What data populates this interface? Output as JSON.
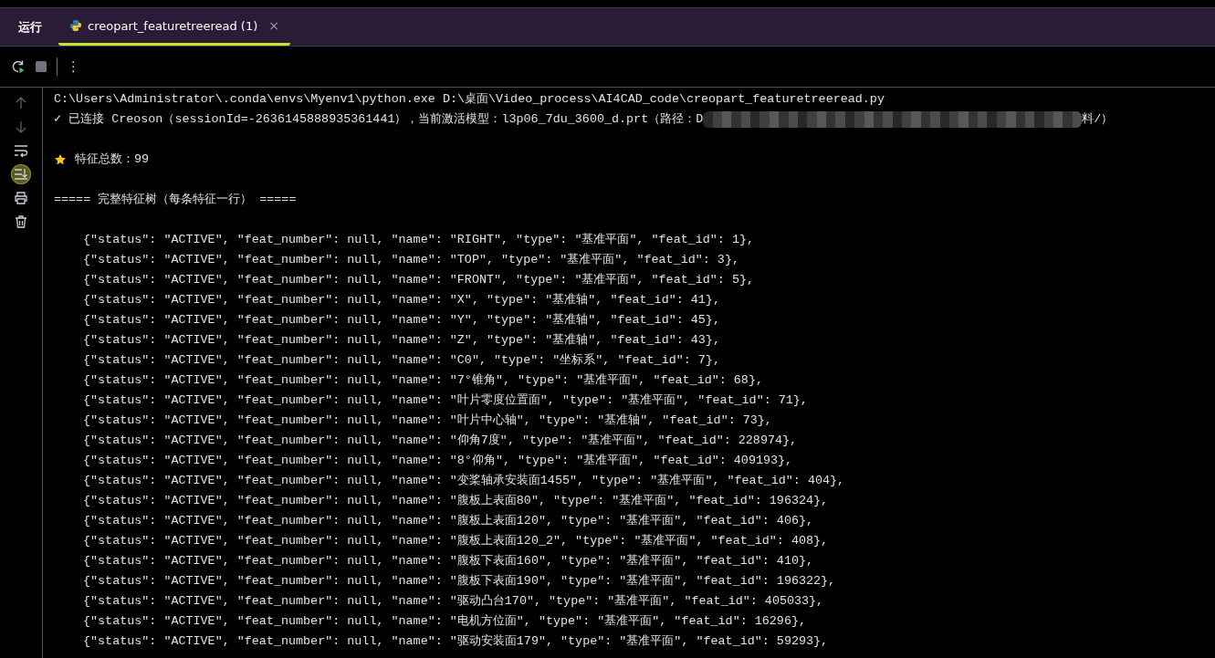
{
  "run_panel": {
    "title": "运行",
    "tabs": [
      {
        "label": "creopart_featuretreeread (1)",
        "selected": true,
        "close": "×"
      }
    ],
    "toolbar": [
      {
        "kind": "rerun"
      },
      {
        "kind": "stop"
      },
      {
        "kind": "divider"
      },
      {
        "kind": "more",
        "label": "⋮"
      }
    ],
    "side_tools": [
      {
        "kind": "up",
        "disabled": true,
        "on": false
      },
      {
        "kind": "down",
        "disabled": true,
        "on": false
      },
      {
        "kind": "wrap",
        "disabled": false,
        "on": false
      },
      {
        "kind": "scroll_end",
        "disabled": false,
        "on": true
      },
      {
        "kind": "print",
        "disabled": false,
        "on": false
      },
      {
        "kind": "trash",
        "disabled": false,
        "on": false
      }
    ],
    "console": {
      "lines": [
        {
          "kind": "command",
          "text": "C:\\Users\\Administrator\\.conda\\envs\\Myenv1\\python.exe D:\\桌面\\Video_process\\AI4CAD_code\\creopart_featuretreeread.py"
        },
        {
          "kind": "status",
          "text": "✓ 已连接 Creoson（sessionId=-2636145888935361441），当前激活模型：l3p06_7du_3600_d.prt（路径：D",
          "redacted": true,
          "tail": "料/）"
        },
        {
          "kind": "blank"
        },
        {
          "kind": "count",
          "text": "特征总数：99"
        },
        {
          "kind": "blank"
        },
        {
          "kind": "heading",
          "text": "===== 完整特征树（每条特征一行） ====="
        },
        {
          "kind": "blank"
        },
        {
          "kind": "row",
          "text": "{\"status\": \"ACTIVE\", \"feat_number\": null, \"name\": \"RIGHT\", \"type\": \"基准平面\", \"feat_id\": 1},"
        },
        {
          "kind": "row",
          "text": "{\"status\": \"ACTIVE\", \"feat_number\": null, \"name\": \"TOP\", \"type\": \"基准平面\", \"feat_id\": 3},"
        },
        {
          "kind": "row",
          "text": "{\"status\": \"ACTIVE\", \"feat_number\": null, \"name\": \"FRONT\", \"type\": \"基准平面\", \"feat_id\": 5},"
        },
        {
          "kind": "row",
          "text": "{\"status\": \"ACTIVE\", \"feat_number\": null, \"name\": \"X\", \"type\": \"基准轴\", \"feat_id\": 41},"
        },
        {
          "kind": "row",
          "text": "{\"status\": \"ACTIVE\", \"feat_number\": null, \"name\": \"Y\", \"type\": \"基准轴\", \"feat_id\": 45},"
        },
        {
          "kind": "row",
          "text": "{\"status\": \"ACTIVE\", \"feat_number\": null, \"name\": \"Z\", \"type\": \"基准轴\", \"feat_id\": 43},"
        },
        {
          "kind": "row",
          "text": "{\"status\": \"ACTIVE\", \"feat_number\": null, \"name\": \"C0\", \"type\": \"坐标系\", \"feat_id\": 7},"
        },
        {
          "kind": "row",
          "text": "{\"status\": \"ACTIVE\", \"feat_number\": null, \"name\": \"7°锥角\", \"type\": \"基准平面\", \"feat_id\": 68},"
        },
        {
          "kind": "row",
          "text": "{\"status\": \"ACTIVE\", \"feat_number\": null, \"name\": \"叶片零度位置面\", \"type\": \"基准平面\", \"feat_id\": 71},"
        },
        {
          "kind": "row",
          "text": "{\"status\": \"ACTIVE\", \"feat_number\": null, \"name\": \"叶片中心轴\", \"type\": \"基准轴\", \"feat_id\": 73},"
        },
        {
          "kind": "row",
          "text": "{\"status\": \"ACTIVE\", \"feat_number\": null, \"name\": \"仰角7度\", \"type\": \"基准平面\", \"feat_id\": 228974},"
        },
        {
          "kind": "row",
          "text": "{\"status\": \"ACTIVE\", \"feat_number\": null, \"name\": \"8°仰角\", \"type\": \"基准平面\", \"feat_id\": 409193},"
        },
        {
          "kind": "row",
          "text": "{\"status\": \"ACTIVE\", \"feat_number\": null, \"name\": \"变桨轴承安装面1455\", \"type\": \"基准平面\", \"feat_id\": 404},"
        },
        {
          "kind": "row",
          "text": "{\"status\": \"ACTIVE\", \"feat_number\": null, \"name\": \"腹板上表面80\", \"type\": \"基准平面\", \"feat_id\": 196324},"
        },
        {
          "kind": "row",
          "text": "{\"status\": \"ACTIVE\", \"feat_number\": null, \"name\": \"腹板上表面120\", \"type\": \"基准平面\", \"feat_id\": 406},"
        },
        {
          "kind": "row",
          "text": "{\"status\": \"ACTIVE\", \"feat_number\": null, \"name\": \"腹板上表面120_2\", \"type\": \"基准平面\", \"feat_id\": 408},"
        },
        {
          "kind": "row",
          "text": "{\"status\": \"ACTIVE\", \"feat_number\": null, \"name\": \"腹板下表面160\", \"type\": \"基准平面\", \"feat_id\": 410},"
        },
        {
          "kind": "row",
          "text": "{\"status\": \"ACTIVE\", \"feat_number\": null, \"name\": \"腹板下表面190\", \"type\": \"基准平面\", \"feat_id\": 196322},"
        },
        {
          "kind": "row",
          "text": "{\"status\": \"ACTIVE\", \"feat_number\": null, \"name\": \"驱动凸台170\", \"type\": \"基准平面\", \"feat_id\": 405033},"
        },
        {
          "kind": "row",
          "text": "{\"status\": \"ACTIVE\", \"feat_number\": null, \"name\": \"电机方位面\", \"type\": \"基准平面\", \"feat_id\": 16296},"
        },
        {
          "kind": "row",
          "text": "{\"status\": \"ACTIVE\", \"feat_number\": null, \"name\": \"驱动安装面179\", \"type\": \"基准平面\", \"feat_id\": 59293},"
        }
      ]
    }
  }
}
